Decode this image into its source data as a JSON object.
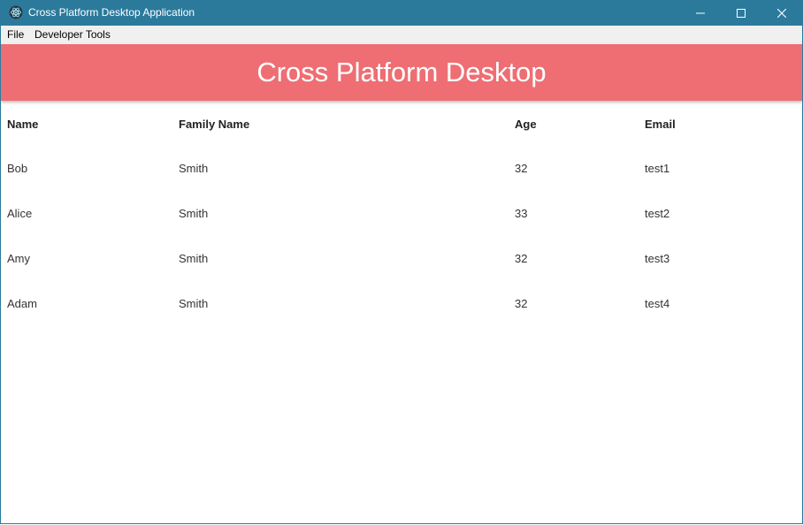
{
  "window": {
    "title": "Cross Platform Desktop Application",
    "icon": "electron-app-icon",
    "controls": [
      "minimize-icon",
      "maximize-icon",
      "close-icon"
    ]
  },
  "menu": {
    "items": [
      "File",
      "Developer Tools"
    ]
  },
  "header": {
    "title": "Cross Platform Desktop",
    "color": "#ee6e73"
  },
  "table": {
    "columns": [
      "Name",
      "Family Name",
      "Age",
      "Email"
    ],
    "rows": [
      [
        "Bob",
        "Smith",
        "32",
        "test1"
      ],
      [
        "Alice",
        "Smith",
        "33",
        "test2"
      ],
      [
        "Amy",
        "Smith",
        "32",
        "test3"
      ],
      [
        "Adam",
        "Smith",
        "32",
        "test4"
      ]
    ]
  },
  "colors": {
    "titlebar": "#2b7a9c",
    "menubar": "#f0f0f0"
  }
}
